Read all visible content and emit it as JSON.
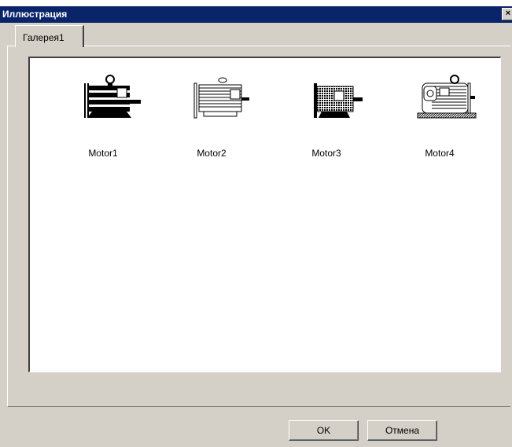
{
  "window": {
    "title": "Иллюстрация",
    "close_glyph": "×"
  },
  "tabs": [
    {
      "label": "Галерея1",
      "active": true
    }
  ],
  "gallery": {
    "items": [
      {
        "label": "Motor1",
        "icon": "motor1-icon"
      },
      {
        "label": "Motor2",
        "icon": "motor2-icon"
      },
      {
        "label": "Motor3",
        "icon": "motor3-icon"
      },
      {
        "label": "Motor4",
        "icon": "motor4-icon"
      }
    ]
  },
  "buttons": {
    "ok_label": "OK",
    "cancel_label": "Отмена"
  },
  "colors": {
    "titlebar": "#0a246a",
    "face": "#d4d0c8"
  }
}
